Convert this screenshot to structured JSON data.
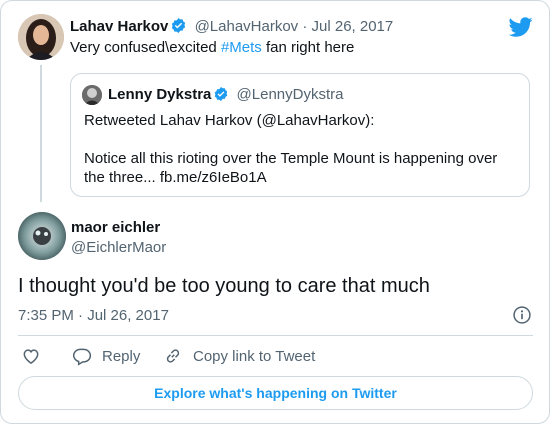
{
  "colors": {
    "accent": "#1d9bf0",
    "muted": "#536471",
    "text": "#0f1419",
    "border": "#cfd9de"
  },
  "original_tweet": {
    "author_name": "Lahav Harkov",
    "handle": "@LahavHarkov",
    "separator": "·",
    "date": "Jul 26, 2017",
    "text_before": "Very confused\\excited ",
    "hashtag": "#Mets",
    "text_after": " fan right here"
  },
  "quoted_tweet": {
    "author_name": "Lenny Dykstra",
    "handle": "@LennyDykstra",
    "line1": "Retweeted Lahav Harkov (@LahavHarkov):",
    "line2": "Notice all this rioting over the Temple Mount is happening over",
    "line3": "the three... fb.me/z6IeBo1A"
  },
  "reply": {
    "author_name": "maor eichler",
    "handle": "@EichlerMaor",
    "text": "I thought you'd be too young to care that much",
    "timestamp": "7:35 PM · Jul 26, 2017"
  },
  "actions": {
    "reply_label": "Reply",
    "copy_label": "Copy link to Tweet"
  },
  "explore_label": "Explore what's happening on Twitter",
  "icons": [
    "twitter-bird-icon",
    "verified-badge-icon",
    "info-icon",
    "heart-icon",
    "reply-bubble-icon",
    "link-icon"
  ]
}
